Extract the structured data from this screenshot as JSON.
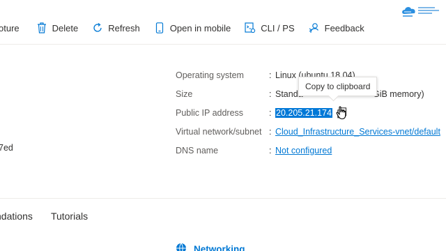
{
  "toolbar": {
    "items": [
      {
        "label": "oture",
        "icon": "capture-icon"
      },
      {
        "label": "Delete",
        "icon": "trash-icon"
      },
      {
        "label": "Refresh",
        "icon": "refresh-icon"
      },
      {
        "label": "Open in mobile",
        "icon": "mobile-icon"
      },
      {
        "label": "CLI / PS",
        "icon": "cli-icon"
      },
      {
        "label": "Feedback",
        "icon": "feedback-icon"
      }
    ]
  },
  "properties": {
    "os": {
      "label": "Operating system",
      "value": "Linux (ubuntu 18.04)"
    },
    "size": {
      "label": "Size",
      "value": "Standa",
      "value_tail": "GiB memory)"
    },
    "ip": {
      "label": "Public IP address",
      "value": "20.205.21.174"
    },
    "vnet": {
      "label": "Virtual network/subnet",
      "value": "Cloud_Infrastructure_Services-vnet/default"
    },
    "dns": {
      "label": "DNS name",
      "value": "Not configured"
    }
  },
  "colon": ":",
  "tooltip": {
    "text": "Copy to clipboard"
  },
  "left_clipped_id": "7ed",
  "tabs": [
    "ndations",
    "Tutorials"
  ],
  "networking": {
    "label": "Networking"
  },
  "colors": {
    "accent": "#0078d4",
    "selection": "#0078d7",
    "text": "#323130",
    "label": "#605e5c"
  }
}
